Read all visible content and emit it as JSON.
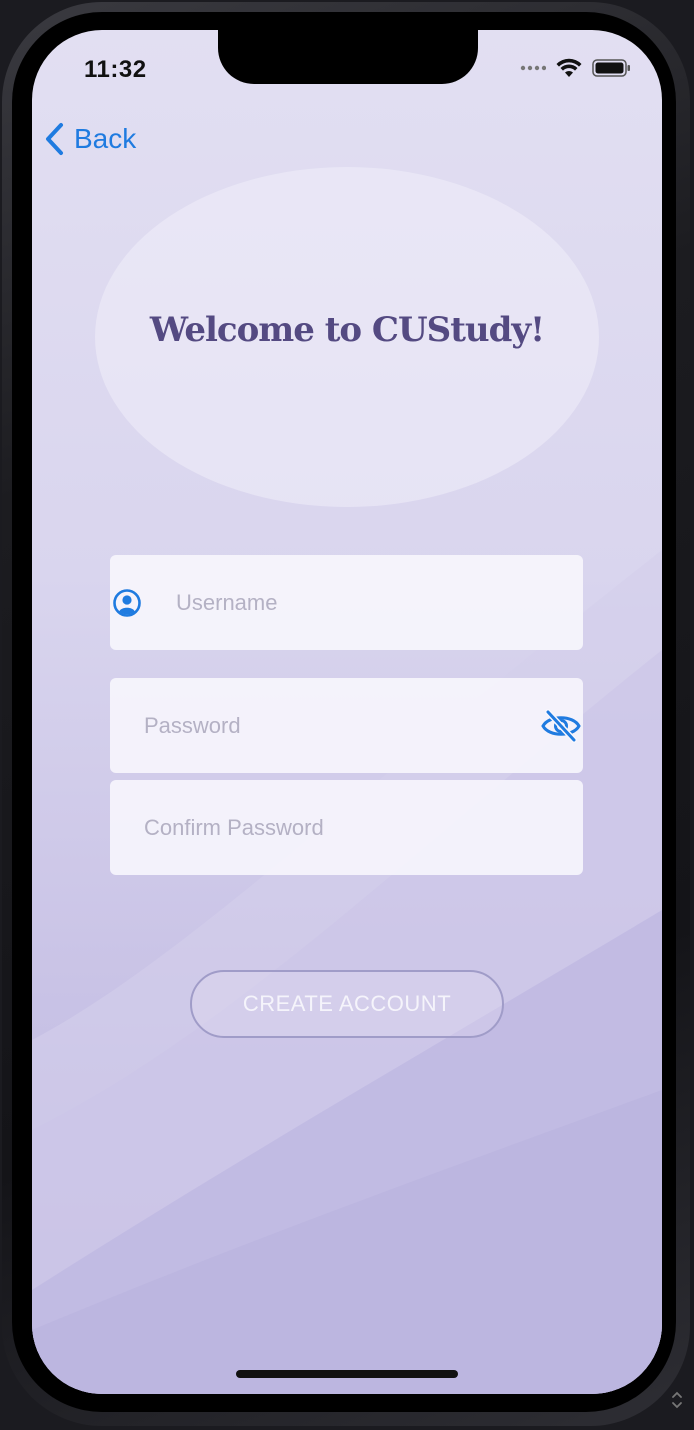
{
  "status_bar": {
    "time": "11:32"
  },
  "nav": {
    "back_label": "Back"
  },
  "header": {
    "title": "Welcome to CUStudy!"
  },
  "form": {
    "username": {
      "value": "",
      "placeholder": "Username"
    },
    "password": {
      "value": "",
      "placeholder": "Password"
    },
    "confirm_password": {
      "value": "",
      "placeholder": "Confirm Password"
    },
    "submit_label": "CREATE ACCOUNT"
  },
  "icons": {
    "back": "chevron-left-icon",
    "username": "user-circle-icon",
    "password_toggle": "eye-slash-icon",
    "wifi": "wifi-icon",
    "battery": "battery-icon"
  },
  "colors": {
    "accent": "#1f7be0",
    "title": "#544a82",
    "background_top": "#e2dff2",
    "background_bottom": "#b9b3df",
    "button_border": "#a09cc8"
  }
}
